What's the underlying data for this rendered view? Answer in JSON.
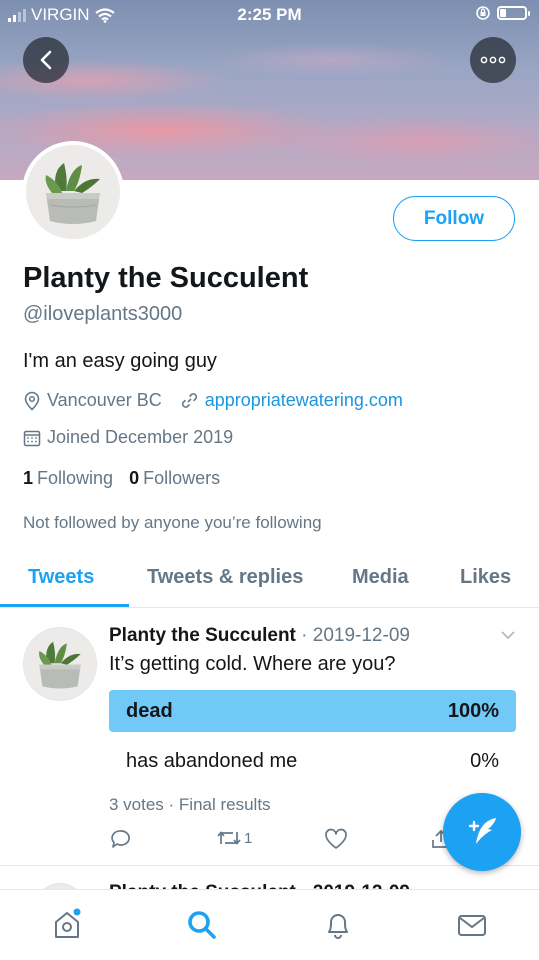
{
  "status_bar": {
    "carrier": "VIRGIN",
    "time": "2:25 PM"
  },
  "profile": {
    "follow_label": "Follow",
    "name": "Planty the Succulent",
    "handle": "@iloveplants3000",
    "bio": "I'm an easy going guy",
    "location": "Vancouver BC",
    "website": "appropriatewatering.com",
    "joined": "Joined December 2019",
    "following_count": "1",
    "following_label": "Following",
    "followers_count": "0",
    "followers_label": "Followers",
    "not_followed": "Not followed by anyone you’re following"
  },
  "tabs": [
    {
      "label": "Tweets",
      "active": true
    },
    {
      "label": "Tweets & replies",
      "active": false
    },
    {
      "label": "Media",
      "active": false
    },
    {
      "label": "Likes",
      "active": false
    }
  ],
  "tweet": {
    "author": "Planty the Succulent",
    "date": "· 2019-12-09",
    "text": "It’s getting cold. Where are you?",
    "poll": [
      {
        "label": "dead",
        "percent": "100%",
        "winner": true
      },
      {
        "label": "has abandoned me",
        "percent": "0%",
        "winner": false
      }
    ],
    "poll_summary": "3 votes · Final results",
    "retweet_count": "1"
  },
  "tweet2_preview": "Planty the Succulent · 2019-12-09",
  "colors": {
    "accent": "#1da1f2",
    "poll_winner": "#71c9f8",
    "secondary_text": "#657786"
  }
}
